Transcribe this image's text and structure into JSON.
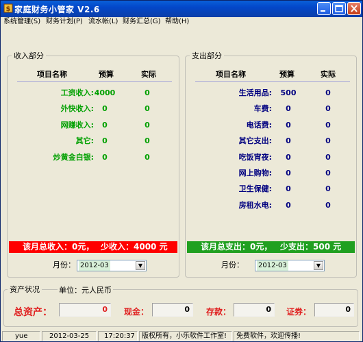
{
  "window": {
    "title": "家庭财务小管家  V2.6"
  },
  "menu": [
    "系统管理(S)",
    "财务计划(P)",
    "流水帐(L)",
    "财务汇总(G)",
    "帮助(H)"
  ],
  "income": {
    "legend": "收入部分",
    "headers": {
      "name": "项目名称",
      "budget": "预算",
      "actual": "实际"
    },
    "rows": [
      {
        "name": "工资收入:",
        "budget": "4000",
        "actual": "0"
      },
      {
        "name": "外快收入:",
        "budget": "0",
        "actual": "0"
      },
      {
        "name": "网赚收入:",
        "budget": "0",
        "actual": "0"
      },
      {
        "name": "其它:",
        "budget": "0",
        "actual": "0"
      },
      {
        "name": "炒黄金白银:",
        "budget": "0",
        "actual": "0"
      }
    ],
    "summary": {
      "total": "该月总收入：0元，",
      "shortfall": "少收入：4000 元"
    },
    "month_label": "月份：",
    "month_value": "2012-03"
  },
  "expense": {
    "legend": "支出部分",
    "headers": {
      "name": "项目名称",
      "budget": "预算",
      "actual": "实际"
    },
    "rows": [
      {
        "name": "生活用品:",
        "budget": "500",
        "actual": "0"
      },
      {
        "name": "车费:",
        "budget": "0",
        "actual": "0"
      },
      {
        "name": "电话费:",
        "budget": "0",
        "actual": "0"
      },
      {
        "name": "其它支出:",
        "budget": "0",
        "actual": "0"
      },
      {
        "name": "吃饭宵夜:",
        "budget": "0",
        "actual": "0"
      },
      {
        "name": "网上购物:",
        "budget": "0",
        "actual": "0"
      },
      {
        "name": "卫生保健:",
        "budget": "0",
        "actual": "0"
      },
      {
        "name": "房租水电:",
        "budget": "0",
        "actual": "0"
      }
    ],
    "summary": {
      "total": "该月总支出：0元，",
      "shortfall": "少支出：500 元"
    },
    "month_label": "月份：",
    "month_value": "2012-03"
  },
  "assets": {
    "legend": "资产状况",
    "unit": "单位：元人民币",
    "total_label": "总资产：",
    "total_value": "0",
    "cash_label": "现金：",
    "cash_value": "0",
    "deposit_label": "存款：",
    "deposit_value": "0",
    "securities_label": "证券：",
    "securities_value": "0"
  },
  "status": [
    "yue",
    "2012-03-25",
    "17:20:37",
    "版权所有，小乐软件工作室!",
    "免费软件，欢迎传播!"
  ],
  "colors": {
    "income_label": "#00a000",
    "expense_label": "#000080",
    "income_bar": "#ff0000",
    "expense_bar": "#20a020",
    "asset_label": "#e02020"
  }
}
